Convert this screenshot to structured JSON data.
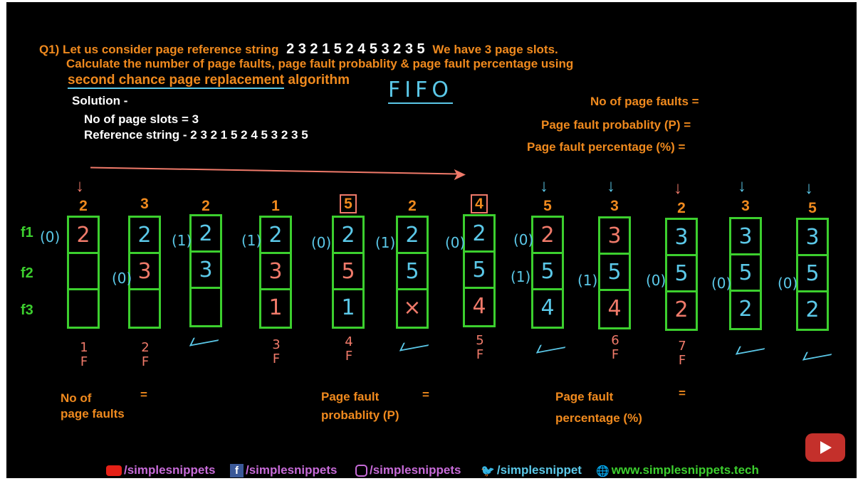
{
  "question": {
    "line1_prefix": "Q1) Let us consider page reference string",
    "line1_string": "2 3 2 1 5 2 4 5 3 2 3 5",
    "line1_suffix": "We have 3 page slots.",
    "line2": "Calculate the number of page faults, page fault probablity & page fault percentage using",
    "line3_underlined": "second chance page replacement",
    "line3_rest": "algorithm"
  },
  "fifo_note": "FIFO",
  "solution": {
    "heading": "Solution -",
    "slots": "No of page slots = 3",
    "ref_string": "Reference string - 2 3 2 1 5 2 4 5 3 2 3 5"
  },
  "results_right": {
    "faults": "No of page faults =",
    "probability": "Page fault probablity (P) =",
    "percentage": "Page fault percentage (%) ="
  },
  "frame_labels": [
    "f1",
    "f2",
    "f3"
  ],
  "columns": [
    {
      "ref": "2",
      "f": [
        "2",
        "",
        ""
      ],
      "fc": [
        "red",
        "",
        ""
      ]
    },
    {
      "ref": "3",
      "f": [
        "2",
        "3",
        ""
      ],
      "fc": [
        "cyan",
        "red",
        ""
      ]
    },
    {
      "ref": "2",
      "f": [
        "2",
        "3",
        ""
      ],
      "fc": [
        "cyan",
        "cyan",
        ""
      ]
    },
    {
      "ref": "1",
      "f": [
        "2",
        "3",
        "1"
      ],
      "fc": [
        "cyan",
        "red",
        "red"
      ]
    },
    {
      "ref": "5",
      "f": [
        "2",
        "5",
        "1"
      ],
      "fc": [
        "cyan",
        "red",
        "cyan"
      ]
    },
    {
      "ref": "2",
      "f": [
        "2",
        "5",
        "×"
      ],
      "fc": [
        "cyan",
        "cyan",
        "red"
      ]
    },
    {
      "ref": "4",
      "f": [
        "2",
        "5",
        "4"
      ],
      "fc": [
        "cyan",
        "cyan",
        "red"
      ]
    },
    {
      "ref": "5",
      "f": [
        "2",
        "5",
        "4"
      ],
      "fc": [
        "red",
        "cyan",
        "cyan"
      ]
    },
    {
      "ref": "3",
      "f": [
        "3",
        "5",
        "4"
      ],
      "fc": [
        "red",
        "cyan",
        "red"
      ]
    },
    {
      "ref": "2",
      "f": [
        "3",
        "5",
        "2"
      ],
      "fc": [
        "cyan",
        "cyan",
        "red"
      ]
    },
    {
      "ref": "3",
      "f": [
        "3",
        "5",
        "2"
      ],
      "fc": [
        "cyan",
        "cyan",
        "cyan"
      ]
    },
    {
      "ref": "5",
      "f": [
        "3",
        "5",
        "2"
      ],
      "fc": [
        "cyan",
        "cyan",
        "cyan"
      ]
    }
  ],
  "bits": [
    "(0)",
    "(0)",
    "(1)",
    "(1)",
    "(0)",
    "(1)",
    "(0)",
    "(0)",
    "(1)",
    "(1)",
    "(0)",
    "(0)",
    "(0)"
  ],
  "fault_marks": [
    {
      "num": "1",
      "f": "F"
    },
    {
      "num": "2",
      "f": "F"
    },
    {
      "num": "3",
      "f": "F"
    },
    {
      "num": "4",
      "f": "F"
    },
    {
      "num": "5",
      "f": "F"
    },
    {
      "num": "6",
      "f": "F"
    },
    {
      "num": "7",
      "f": "F"
    }
  ],
  "bottom": {
    "faults_l1": "No of",
    "faults_l2": "page faults",
    "eq": "=",
    "prob_l1": "Page fault",
    "prob_l2": "probablity (P)",
    "pct_l1": "Page fault",
    "pct_l2": "percentage (%)"
  },
  "social": {
    "youtube": "/simplesnippets",
    "facebook": "/simplesnippets",
    "instagram": "/simplesnippets",
    "twitter": "/simplesnippet",
    "web": "www.simplesnippets.tech"
  },
  "colors": {
    "orange": "#f08a1e",
    "green": "#3ccf2e",
    "cyan": "#5bc8e8",
    "red": "#f07a6a"
  }
}
